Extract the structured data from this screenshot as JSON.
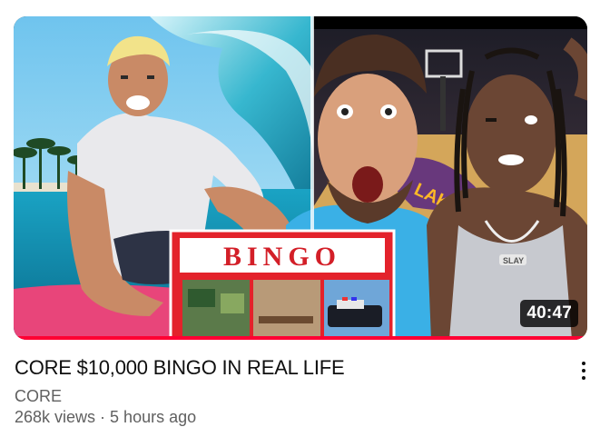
{
  "video": {
    "title": "CORE $10,000 BINGO IN REAL LIFE",
    "channel": "CORE",
    "views": "268k views",
    "separator": "·",
    "age": "5 hours ago",
    "duration": "40:47",
    "watched_fraction": 1.0
  },
  "thumbnail": {
    "sign_text": "BINGO",
    "court_text": "LAKERS",
    "chain_text": "SLAY"
  },
  "icons": {
    "menu": "more-vert-icon"
  },
  "colors": {
    "progress": "#ff0033",
    "title": "#0f0f0f",
    "secondary": "#606060"
  }
}
